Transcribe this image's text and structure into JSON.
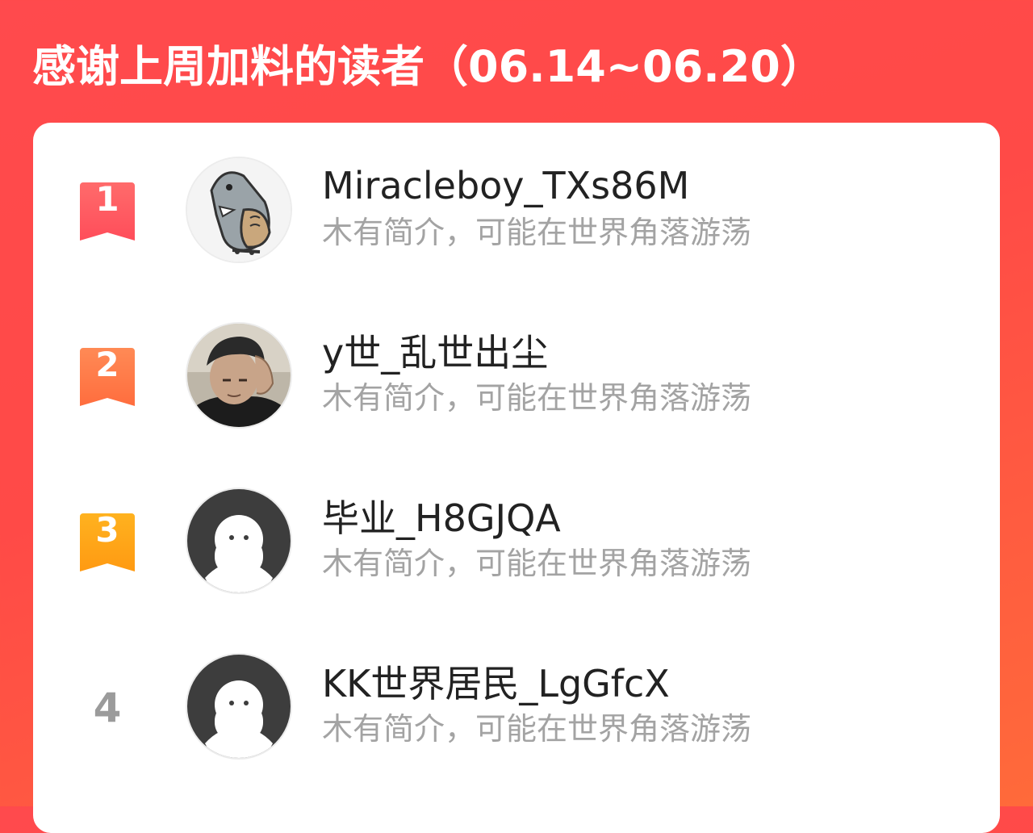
{
  "header": {
    "title": "感谢上周加料的读者（06.14~06.20）"
  },
  "readers": [
    {
      "rank": "1",
      "name": "Miracleboy_TXs86M",
      "bio": "木有简介，可能在世界角落游荡",
      "avatar": "shark-bird-avatar",
      "badge_color": "#ff5a5f"
    },
    {
      "rank": "2",
      "name": "y世_乱世出尘",
      "bio": "木有简介，可能在世界角落游荡",
      "avatar": "photo-avatar",
      "badge_color": "#ff7b4a"
    },
    {
      "rank": "3",
      "name": "毕业_H8GJQA",
      "bio": "木有简介，可能在世界角落游荡",
      "avatar": "default-avatar",
      "badge_color": "#ffa019"
    },
    {
      "rank": "4",
      "name": "KK世界居民_LgGfcX",
      "bio": "木有简介，可能在世界角落游荡",
      "avatar": "default-avatar",
      "badge_color": "#9b9b9b"
    }
  ]
}
